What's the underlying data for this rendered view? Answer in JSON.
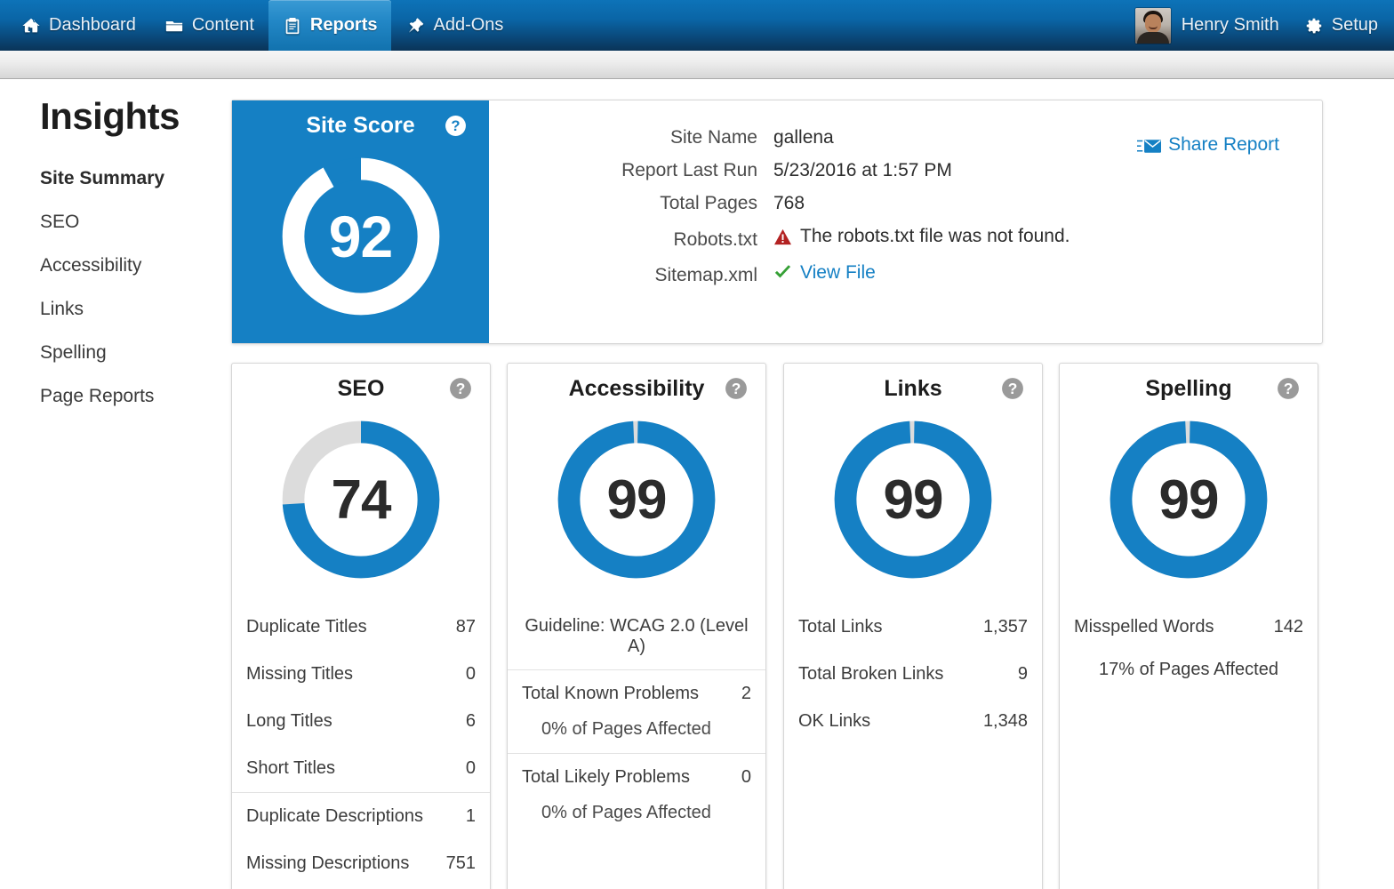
{
  "nav": {
    "items": [
      {
        "label": "Dashboard",
        "icon": "home-icon",
        "active": false
      },
      {
        "label": "Content",
        "icon": "folder-icon",
        "active": false
      },
      {
        "label": "Reports",
        "icon": "clipboard-icon",
        "active": true
      },
      {
        "label": "Add-Ons",
        "icon": "pushpin-icon",
        "active": false
      }
    ],
    "user_name": "Henry Smith",
    "setup_label": "Setup",
    "avatar": "user-photo-avatar"
  },
  "sidebar": {
    "title": "Insights",
    "items": [
      {
        "label": "Site Summary",
        "active": true
      },
      {
        "label": "SEO",
        "active": false
      },
      {
        "label": "Accessibility",
        "active": false
      },
      {
        "label": "Links",
        "active": false
      },
      {
        "label": "Spelling",
        "active": false
      },
      {
        "label": "Page Reports",
        "active": false
      }
    ]
  },
  "site_score": {
    "title": "Site Score",
    "value": "92",
    "help": "?"
  },
  "report_info": {
    "share_label": "Share Report",
    "rows": [
      {
        "label": "Site Name",
        "value": "gallena",
        "kind": "text"
      },
      {
        "label": "Report Last Run",
        "value": "5/23/2016 at 1:57 PM",
        "kind": "text"
      },
      {
        "label": "Total Pages",
        "value": "768",
        "kind": "text"
      },
      {
        "label": "Robots.txt",
        "value": "The robots.txt file was not found.",
        "kind": "warning"
      },
      {
        "label": "Sitemap.xml",
        "value": "View File",
        "kind": "link-ok"
      }
    ]
  },
  "cards": {
    "seo": {
      "title": "SEO",
      "score": "74",
      "help": "?",
      "stats": [
        {
          "label": "Duplicate Titles",
          "value": "87"
        },
        {
          "label": "Missing Titles",
          "value": "0"
        },
        {
          "label": "Long Titles",
          "value": "6"
        },
        {
          "label": "Short Titles",
          "value": "0"
        },
        {
          "label": "Duplicate Descriptions",
          "value": "1"
        },
        {
          "label": "Missing Descriptions",
          "value": "751"
        }
      ]
    },
    "accessibility": {
      "title": "Accessibility",
      "score": "99",
      "help": "?",
      "guideline": "Guideline: WCAG 2.0 (Level A)",
      "groups": [
        {
          "label": "Total Known Problems",
          "value": "2",
          "sub": "0% of Pages Affected"
        },
        {
          "label": "Total Likely Problems",
          "value": "0",
          "sub": "0% of Pages Affected"
        }
      ]
    },
    "links": {
      "title": "Links",
      "score": "99",
      "help": "?",
      "stats": [
        {
          "label": "Total Links",
          "value": "1,357"
        },
        {
          "label": "Total Broken Links",
          "value": "9"
        },
        {
          "label": "OK Links",
          "value": "1,348"
        }
      ]
    },
    "spelling": {
      "title": "Spelling",
      "score": "99",
      "help": "?",
      "stats": [
        {
          "label": "Misspelled Words",
          "value": "142"
        }
      ],
      "sub": "17% of Pages Affected"
    }
  },
  "chart_data": [
    {
      "type": "pie",
      "title": "Site Score",
      "variant": "donut-gauge",
      "value": 92,
      "max": 100,
      "labels": [
        "Score",
        "Remaining"
      ],
      "values": [
        92,
        8
      ],
      "colors": [
        "#ffffff",
        "#1580c4"
      ],
      "center_label": "92"
    },
    {
      "type": "pie",
      "title": "SEO",
      "variant": "donut-gauge",
      "value": 74,
      "max": 100,
      "labels": [
        "Score",
        "Remaining"
      ],
      "values": [
        74,
        26
      ],
      "colors": [
        "#1580c4",
        "#dcdcdc"
      ],
      "center_label": "74"
    },
    {
      "type": "pie",
      "title": "Accessibility",
      "variant": "donut-gauge",
      "value": 99,
      "max": 100,
      "labels": [
        "Score",
        "Remaining"
      ],
      "values": [
        99,
        1
      ],
      "colors": [
        "#1580c4",
        "#dcdcdc"
      ],
      "center_label": "99"
    },
    {
      "type": "pie",
      "title": "Links",
      "variant": "donut-gauge",
      "value": 99,
      "max": 100,
      "labels": [
        "Score",
        "Remaining"
      ],
      "values": [
        99,
        1
      ],
      "colors": [
        "#1580c4",
        "#dcdcdc"
      ],
      "center_label": "99"
    },
    {
      "type": "pie",
      "title": "Spelling",
      "variant": "donut-gauge",
      "value": 99,
      "max": 100,
      "labels": [
        "Score",
        "Remaining"
      ],
      "values": [
        99,
        1
      ],
      "colors": [
        "#1580c4",
        "#dcdcdc"
      ],
      "center_label": "99"
    }
  ],
  "colors": {
    "brand_blue": "#1580c4",
    "nav_top": "#0d73b8",
    "nav_bottom": "#0a3458",
    "track_gray": "#dcdcdc",
    "warning_red": "#b32222",
    "success_green": "#35a035"
  }
}
